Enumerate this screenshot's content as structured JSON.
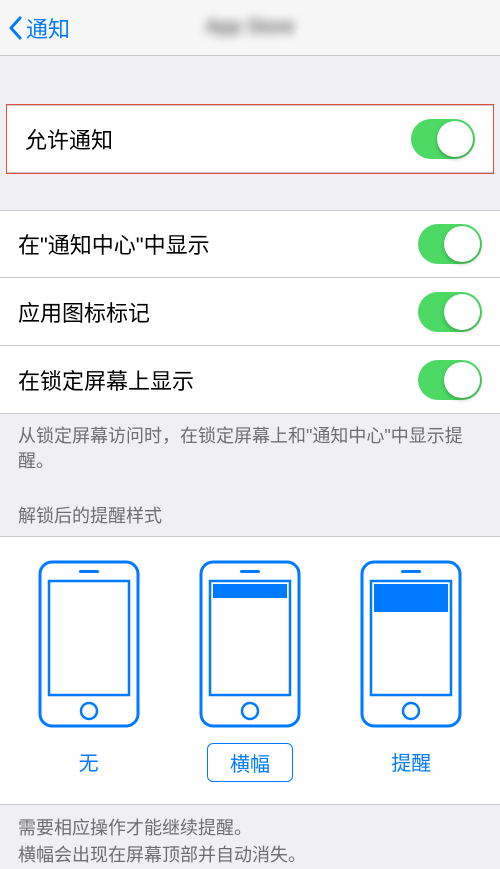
{
  "nav": {
    "back_label": "通知",
    "title": "App Store"
  },
  "allow": {
    "label": "允许通知",
    "on": true
  },
  "group": [
    {
      "label": "在\"通知中心\"中显示",
      "on": true
    },
    {
      "label": "应用图标标记",
      "on": true
    },
    {
      "label": "在锁定屏幕上显示",
      "on": true
    }
  ],
  "group_footer": "从锁定屏幕访问时，在锁定屏幕上和\"通知中心\"中显示提醒。",
  "style_header": "解锁后的提醒样式",
  "styles": [
    {
      "label": "无",
      "selected": false
    },
    {
      "label": "横幅",
      "selected": true
    },
    {
      "label": "提醒",
      "selected": false
    }
  ],
  "panel_footer_line1": "需要相应操作才能继续提醒。",
  "panel_footer_line2": "横幅会出现在屏幕顶部并自动消失。",
  "colors": {
    "tint": "#007aff",
    "switch_on": "#4cd964"
  }
}
